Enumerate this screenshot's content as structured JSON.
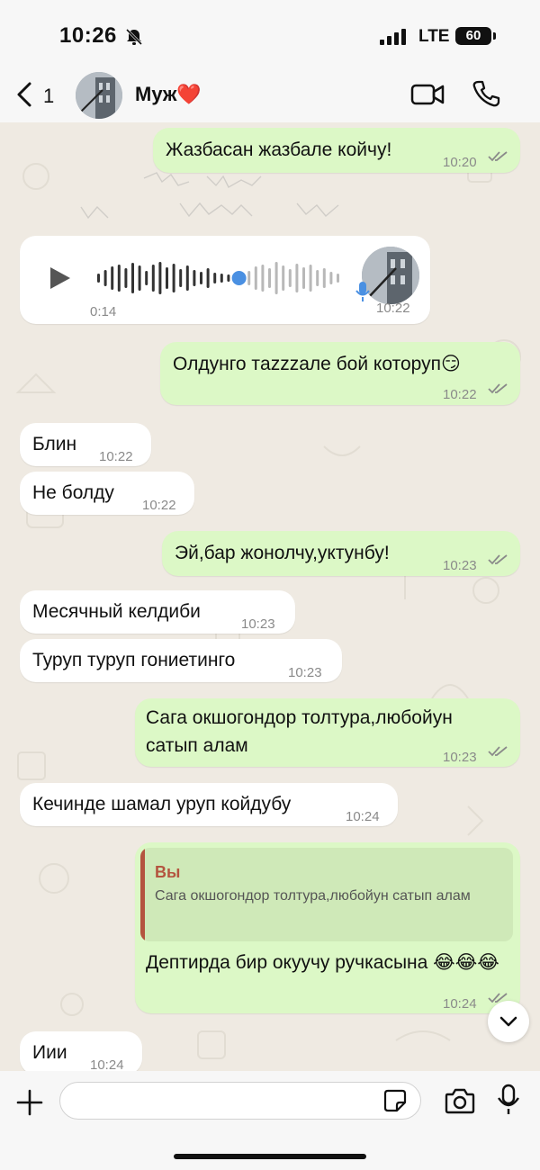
{
  "status_bar": {
    "time": "10:26",
    "network": "LTE",
    "battery": "60"
  },
  "header": {
    "back_count": "1",
    "contact_name": "Муж❤️"
  },
  "messages": [
    {
      "text": "Жазбасан жазбале койчу!",
      "time": "10:20"
    },
    {
      "duration": "0:14",
      "time": "10:22"
    },
    {
      "text": "Олдунго тazzzале бой которуп😏",
      "time": "10:22"
    },
    {
      "text": "Блин",
      "time": "10:22"
    },
    {
      "text": "Не болду",
      "time": "10:22"
    },
    {
      "text": "Эй,бар жонолчу,уктунбу!",
      "time": "10:23"
    },
    {
      "text": "Месячный келдиби",
      "time": "10:23"
    },
    {
      "text": "Туруп туруп гониетинго",
      "time": "10:23"
    },
    {
      "text": "Сага окшогондор толтура,любойун сатып алам",
      "time": "10:23"
    },
    {
      "text": "Кечинде шамал уруп койдубу",
      "time": "10:24"
    },
    {
      "quote_author": "Вы",
      "quote_text": "Сага окшогондор толтура,любойун сатып алам",
      "text": "Дептирда бир окуучу ручкасына 😂😂😂",
      "time": "10:24"
    },
    {
      "text": "Иии",
      "time": "10:24"
    }
  ],
  "composer": {
    "placeholder": ""
  },
  "colors": {
    "outgoing_bubble": "#dcf8c6",
    "incoming_bubble": "#ffffff",
    "quote_accent": "#b4543f",
    "voice_progress": "#4a90e2",
    "read_ticks": "#8a8a8a"
  },
  "icons": [
    "bell-slash-icon",
    "signal-icon",
    "back-chevron-icon",
    "video-call-icon",
    "phone-icon",
    "play-icon",
    "microphone-icon",
    "double-check-icon",
    "chevron-down-icon",
    "plus-icon",
    "sticker-icon",
    "camera-icon"
  ]
}
